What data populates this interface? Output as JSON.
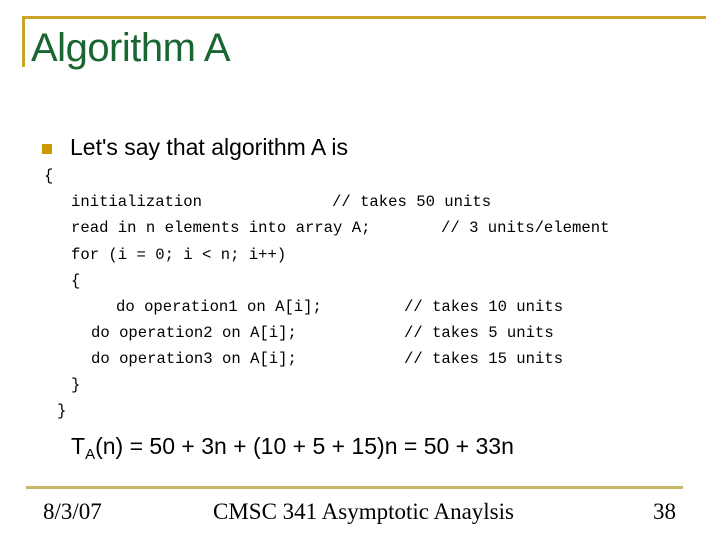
{
  "slide": {
    "title": "Algorithm A",
    "bullet": "Let's say that algorithm A is",
    "code_lines": [
      {
        "text": "{",
        "indent": 0
      },
      {
        "text": "initialization",
        "comment": "// takes 50 units"
      },
      {
        "text": "read in n elements into array A;",
        "comment": "// 3 units/element"
      },
      {
        "text": "for (i = 0; i < n; i++)"
      },
      {
        "text": "{"
      },
      {
        "text": "do operation1 on A[i];",
        "comment": "// takes 10 units"
      },
      {
        "text": "do operation2 on A[i];",
        "comment": "// takes 5 units"
      },
      {
        "text": "do operation3 on A[i];",
        "comment": "// takes 15 units"
      },
      {
        "text": "}"
      },
      {
        "text": "}"
      }
    ],
    "formula": {
      "lhs_base": "T",
      "lhs_sub": "A",
      "rest": "(n) = 50 + 3n + (10 + 5 + 15)n = 50 + 33n"
    }
  },
  "footer": {
    "date": "8/3/07",
    "course": "CMSC 341 Asymptotic Anaylsis",
    "page_number": "38"
  },
  "colors": {
    "title": "#1a6633",
    "accent_rule": "#c9a227",
    "bullet": "#cc9900",
    "footer_rule": "#c7b86a"
  }
}
